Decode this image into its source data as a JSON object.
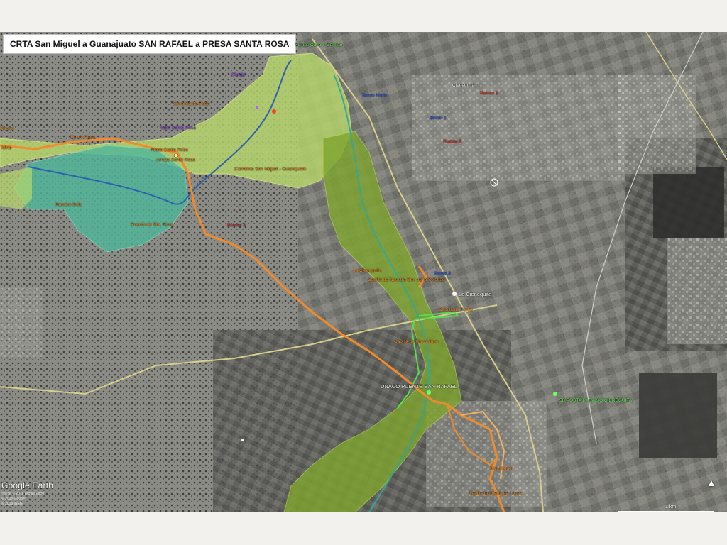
{
  "title": "CRTA San Miguel a Guanajuato SAN RAFAEL a PRESA SANTA ROSA",
  "branding": {
    "logo_text": "Google Earth",
    "credits": [
      "Image © 2018 DigitalGlobe",
      "© 2018 Google",
      "© 2018 INEGI"
    ]
  },
  "scale": {
    "label": "1 km"
  },
  "colors": {
    "route_orange": "#f08a2a",
    "river_blue": "#2f5fb0",
    "zone_light_green": "#b6d86a",
    "zone_teal": "#4fb79b",
    "zone_olive": "#7fa52e",
    "road_yellow": "#d8cf8c",
    "trail_green": "#54e04a"
  },
  "labels": {
    "top_placemark": "Ruinas Casa Y Damián",
    "cienequita_top": "Cieneguita",
    "cienequita_main": "La Cieneguita",
    "presa": "Presa Santa Rosa",
    "capilla_fortin": "Capilla de Fortín",
    "capilla_soledad": "Capilla de Nuestra Sra. de la Soledad",
    "capilla_indigena": "Capilla Indígena San Isidro",
    "capilla_guadalupe": "Capilla de Guadalupe",
    "capilla_indios": "Capilla Indígena de Lopez",
    "unaco": "UNACO PUENTE SAN RAFAEL",
    "posta": "5B POSTA PARAISO CIENEGUITA",
    "cerro": "Cerro Santa Rosa",
    "la_cieneguita_orange": "La Cieneguita",
    "arroyo": "Arroyo Santa Rosa",
    "sanrafael": "San Rafael",
    "rancho": "Rancho Solo",
    "mina": "Mina",
    "carretera": "Carretera San Miguel - Guanajuato",
    "puente": "Puente de Sta. Rosa",
    "agua": "Ojo de Agua",
    "chorro": "Chorro",
    "red1": "Ruinas 1",
    "red2": "Ruinas 2",
    "red3": "Ruinas 3",
    "blue1": "Bordo 1",
    "blue2": "Bordo Norte",
    "blue3": "Bordo 3",
    "purple1": "Obraje",
    "purple2": "Valle Santa Rosa"
  }
}
